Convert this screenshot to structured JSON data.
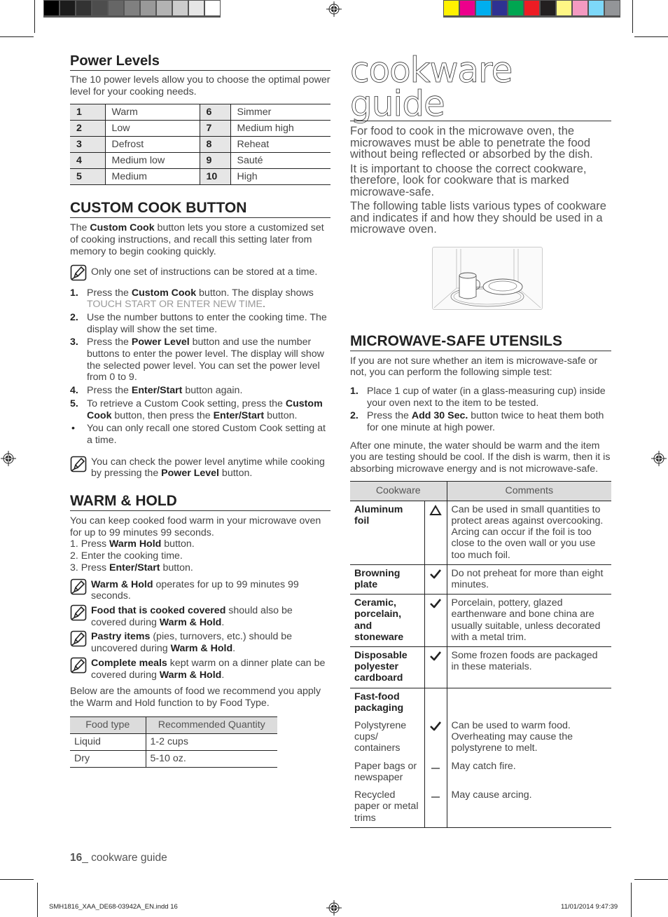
{
  "print_marks": {
    "gray_swatches": [
      "#000000",
      "#1c1c1c",
      "#333333",
      "#4d4d4d",
      "#666666",
      "#808080",
      "#999999",
      "#b3b3b3",
      "#cccccc",
      "#e6e6e6",
      "#ffffff"
    ],
    "color_swatches": [
      "#fff200",
      "#ec008c",
      "#00aeef",
      "#2e3192",
      "#00a651",
      "#ed1c24",
      "#231f20",
      "#fff685",
      "#f49ac1",
      "#7dd8f9",
      "#939598"
    ]
  },
  "power_levels": {
    "heading": "Power Levels",
    "intro": "The 10 power levels allow you to choose the optimal power level for your cooking needs.",
    "rows": [
      {
        "n1": "1",
        "l1": "Warm",
        "n2": "6",
        "l2": "Simmer"
      },
      {
        "n1": "2",
        "l1": "Low",
        "n2": "7",
        "l2": "Medium high"
      },
      {
        "n1": "3",
        "l1": "Defrost",
        "n2": "8",
        "l2": "Reheat"
      },
      {
        "n1": "4",
        "l1": "Medium low",
        "n2": "9",
        "l2": "Sauté"
      },
      {
        "n1": "5",
        "l1": "Medium",
        "n2": "10",
        "l2": "High"
      }
    ]
  },
  "custom_cook": {
    "heading": "CUSTOM COOK BUTTON",
    "intro_pre": "The ",
    "intro_bold": "Custom Cook",
    "intro_post": " button lets you store a customized set of cooking instructions, and recall this setting later from memory to begin cooking quickly.",
    "note1": "Only one set of instructions can be stored at a time.",
    "steps": [
      {
        "n": "1.",
        "pre": "Press the ",
        "bold": "Custom Cook",
        "post": " button. The display shows ",
        "display": "TOUCH START OR ENTER NEW TIME",
        "end": "."
      },
      {
        "n": "2.",
        "text": "Use the number buttons to enter the cooking time. The display will show the set time."
      },
      {
        "n": "3.",
        "pre": "Press the ",
        "bold": "Power Level",
        "post": " button and use the number buttons to enter the power level. The display will show the selected power level. You can set the power level from 0 to 9."
      },
      {
        "n": "4.",
        "pre": "Press the ",
        "bold": "Enter/Start",
        "post": " button again."
      },
      {
        "n": "5.",
        "pre": "To retrieve a Custom Cook setting, press the ",
        "bold": "Custom Cook",
        "mid": " button, then press the ",
        "bold2": "Enter/Start",
        "post": " button."
      },
      {
        "n": "•",
        "text": "You can only recall one stored Custom Cook setting at a time."
      }
    ],
    "note2_pre": "You can check the power level anytime while cooking by pressing the ",
    "note2_bold": "Power Level",
    "note2_post": " button."
  },
  "warm_hold": {
    "heading": "WARM & HOLD",
    "intro": "You can keep cooked food warm in your microwave oven for up to 99 minutes 99 seconds.",
    "step1_pre": "1. Press ",
    "step1_bold": "Warm Hold",
    "step1_post": " button.",
    "step2": "2. Enter the cooking time.",
    "step3_pre": "3. Press ",
    "step3_bold": "Enter/Start",
    "step3_post": " button.",
    "notes": [
      {
        "bold": "Warm & Hold",
        "text": " operates for up to 99 minutes 99 seconds.",
        "bold2": "",
        "end": ""
      },
      {
        "bold": "Food that is cooked covered",
        "text": " should also be covered during ",
        "bold2": "Warm & Hold",
        "end": "."
      },
      {
        "bold": "Pastry items",
        "text": " (pies, turnovers, etc.) should be uncovered during ",
        "bold2": "Warm & Hold",
        "end": "."
      },
      {
        "bold": "Complete meals",
        "text": " kept warm on a dinner plate can be covered during ",
        "bold2": "Warm & Hold",
        "end": "."
      }
    ],
    "below": "Below are the amounts of food we recommend you apply the Warm and Hold function to by Food Type.",
    "table": {
      "headers": [
        "Food type",
        "Recommended Quantity"
      ],
      "rows": [
        [
          "Liquid",
          "1-2 cups"
        ],
        [
          "Dry",
          "5-10 oz."
        ]
      ]
    }
  },
  "cookware_guide": {
    "title": "cookware guide",
    "paragraphs": [
      "For food to cook in the microwave oven, the microwaves must be able to penetrate the food without being reflected or absorbed by the dish.",
      "It is important to choose the correct cookware, therefore, look for cookware that is marked microwave-safe.",
      "The following table lists various types of cookware and indicates if and how they should be used in a microwave oven."
    ]
  },
  "microwave_safe": {
    "heading": "MICROWAVE-SAFE UTENSILS",
    "intro": "If you are not sure whether an item is microwave-safe or not, you can perform the following simple test:",
    "step1": "Place 1 cup of water (in a glass-measuring cup) inside your oven next to the item to be tested.",
    "step2_pre": "Press the ",
    "step2_bold": "Add 30 Sec.",
    "step2_post": " button twice to heat them both for one minute at high power.",
    "after": "After one minute, the water should be warm and the item you are testing should be cool. If the dish is warm, then it is absorbing microwave energy and is not microwave-safe.",
    "table": {
      "headers": [
        "Cookware",
        "Comments"
      ],
      "rows": [
        {
          "item": "Aluminum foil",
          "bold": true,
          "symbol": "caution-triangle",
          "comment": "Can be used in small quantities to protect areas against overcooking. Arcing can occur if the foil is too close to the oven wall or you use too much foil."
        },
        {
          "item": "Browning plate",
          "bold": true,
          "symbol": "check",
          "comment": "Do not preheat for more than eight minutes."
        },
        {
          "item": "Ceramic, porcelain, and stoneware",
          "bold": true,
          "symbol": "check",
          "comment": "Porcelain, pottery, glazed earthenware and bone china are usually suitable, unless decorated with a metal trim."
        },
        {
          "item": "Disposable polyester cardboard",
          "bold": true,
          "symbol": "check",
          "comment": "Some frozen foods are packaged in these materials."
        },
        {
          "item": "Fast-food packaging",
          "bold": true,
          "symbol": "",
          "comment": ""
        },
        {
          "item": "Polystyrene cups/ containers",
          "bold": false,
          "symbol": "check",
          "comment": "Can be used to warm food. Overheating may cause the polystyrene to melt."
        },
        {
          "item": "Paper bags or newspaper",
          "bold": false,
          "symbol": "dash",
          "comment": "May catch fire."
        },
        {
          "item": "Recycled paper or metal trims",
          "bold": false,
          "symbol": "dash",
          "comment": "May cause arcing."
        }
      ]
    }
  },
  "footer": {
    "page_number": "16",
    "page_label": "_ cookware guide",
    "slug_file": "SMH1816_XAA_DE68-03942A_EN.indd   16",
    "slug_date": "11/01/2014   9:47:39"
  }
}
